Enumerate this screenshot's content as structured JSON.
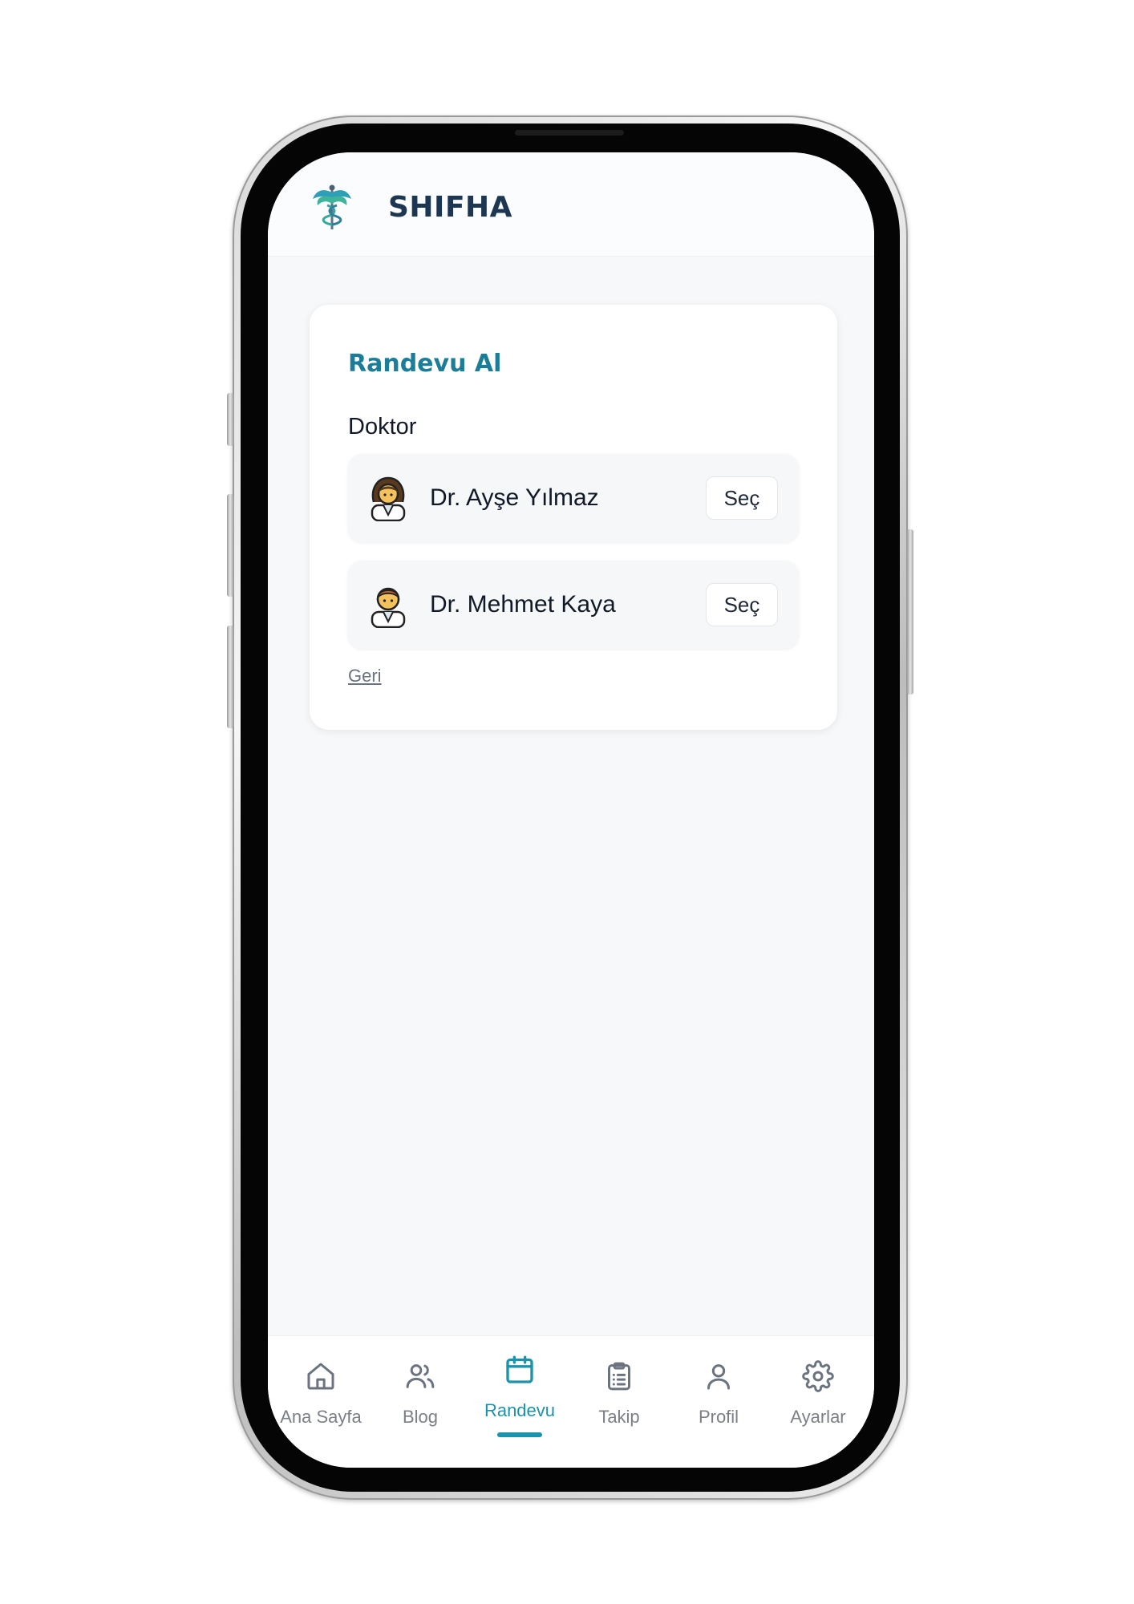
{
  "app": {
    "brand": "SHIFHA"
  },
  "appointment": {
    "title": "Randevu Al",
    "doctor_label": "Doktor",
    "doctors": [
      {
        "name": "Dr. Ayşe Yılmaz",
        "select_label": "Seç",
        "avatar_icon": "female-doctor-icon"
      },
      {
        "name": "Dr. Mehmet Kaya",
        "select_label": "Seç",
        "avatar_icon": "male-doctor-icon"
      }
    ],
    "back_label": "Geri"
  },
  "nav": {
    "active": "Randevu",
    "items": [
      {
        "label": "Ana Sayfa",
        "icon": "home-icon"
      },
      {
        "label": "Blog",
        "icon": "users-icon"
      },
      {
        "label": "Randevu",
        "icon": "calendar-icon"
      },
      {
        "label": "Takip",
        "icon": "clipboard-icon"
      },
      {
        "label": "Profil",
        "icon": "user-icon"
      },
      {
        "label": "Ayarlar",
        "icon": "gear-icon"
      }
    ]
  },
  "colors": {
    "accent": "#1b93ad",
    "title": "#1b7d98",
    "brand": "#1d3652",
    "inactive": "#7b7f86"
  }
}
